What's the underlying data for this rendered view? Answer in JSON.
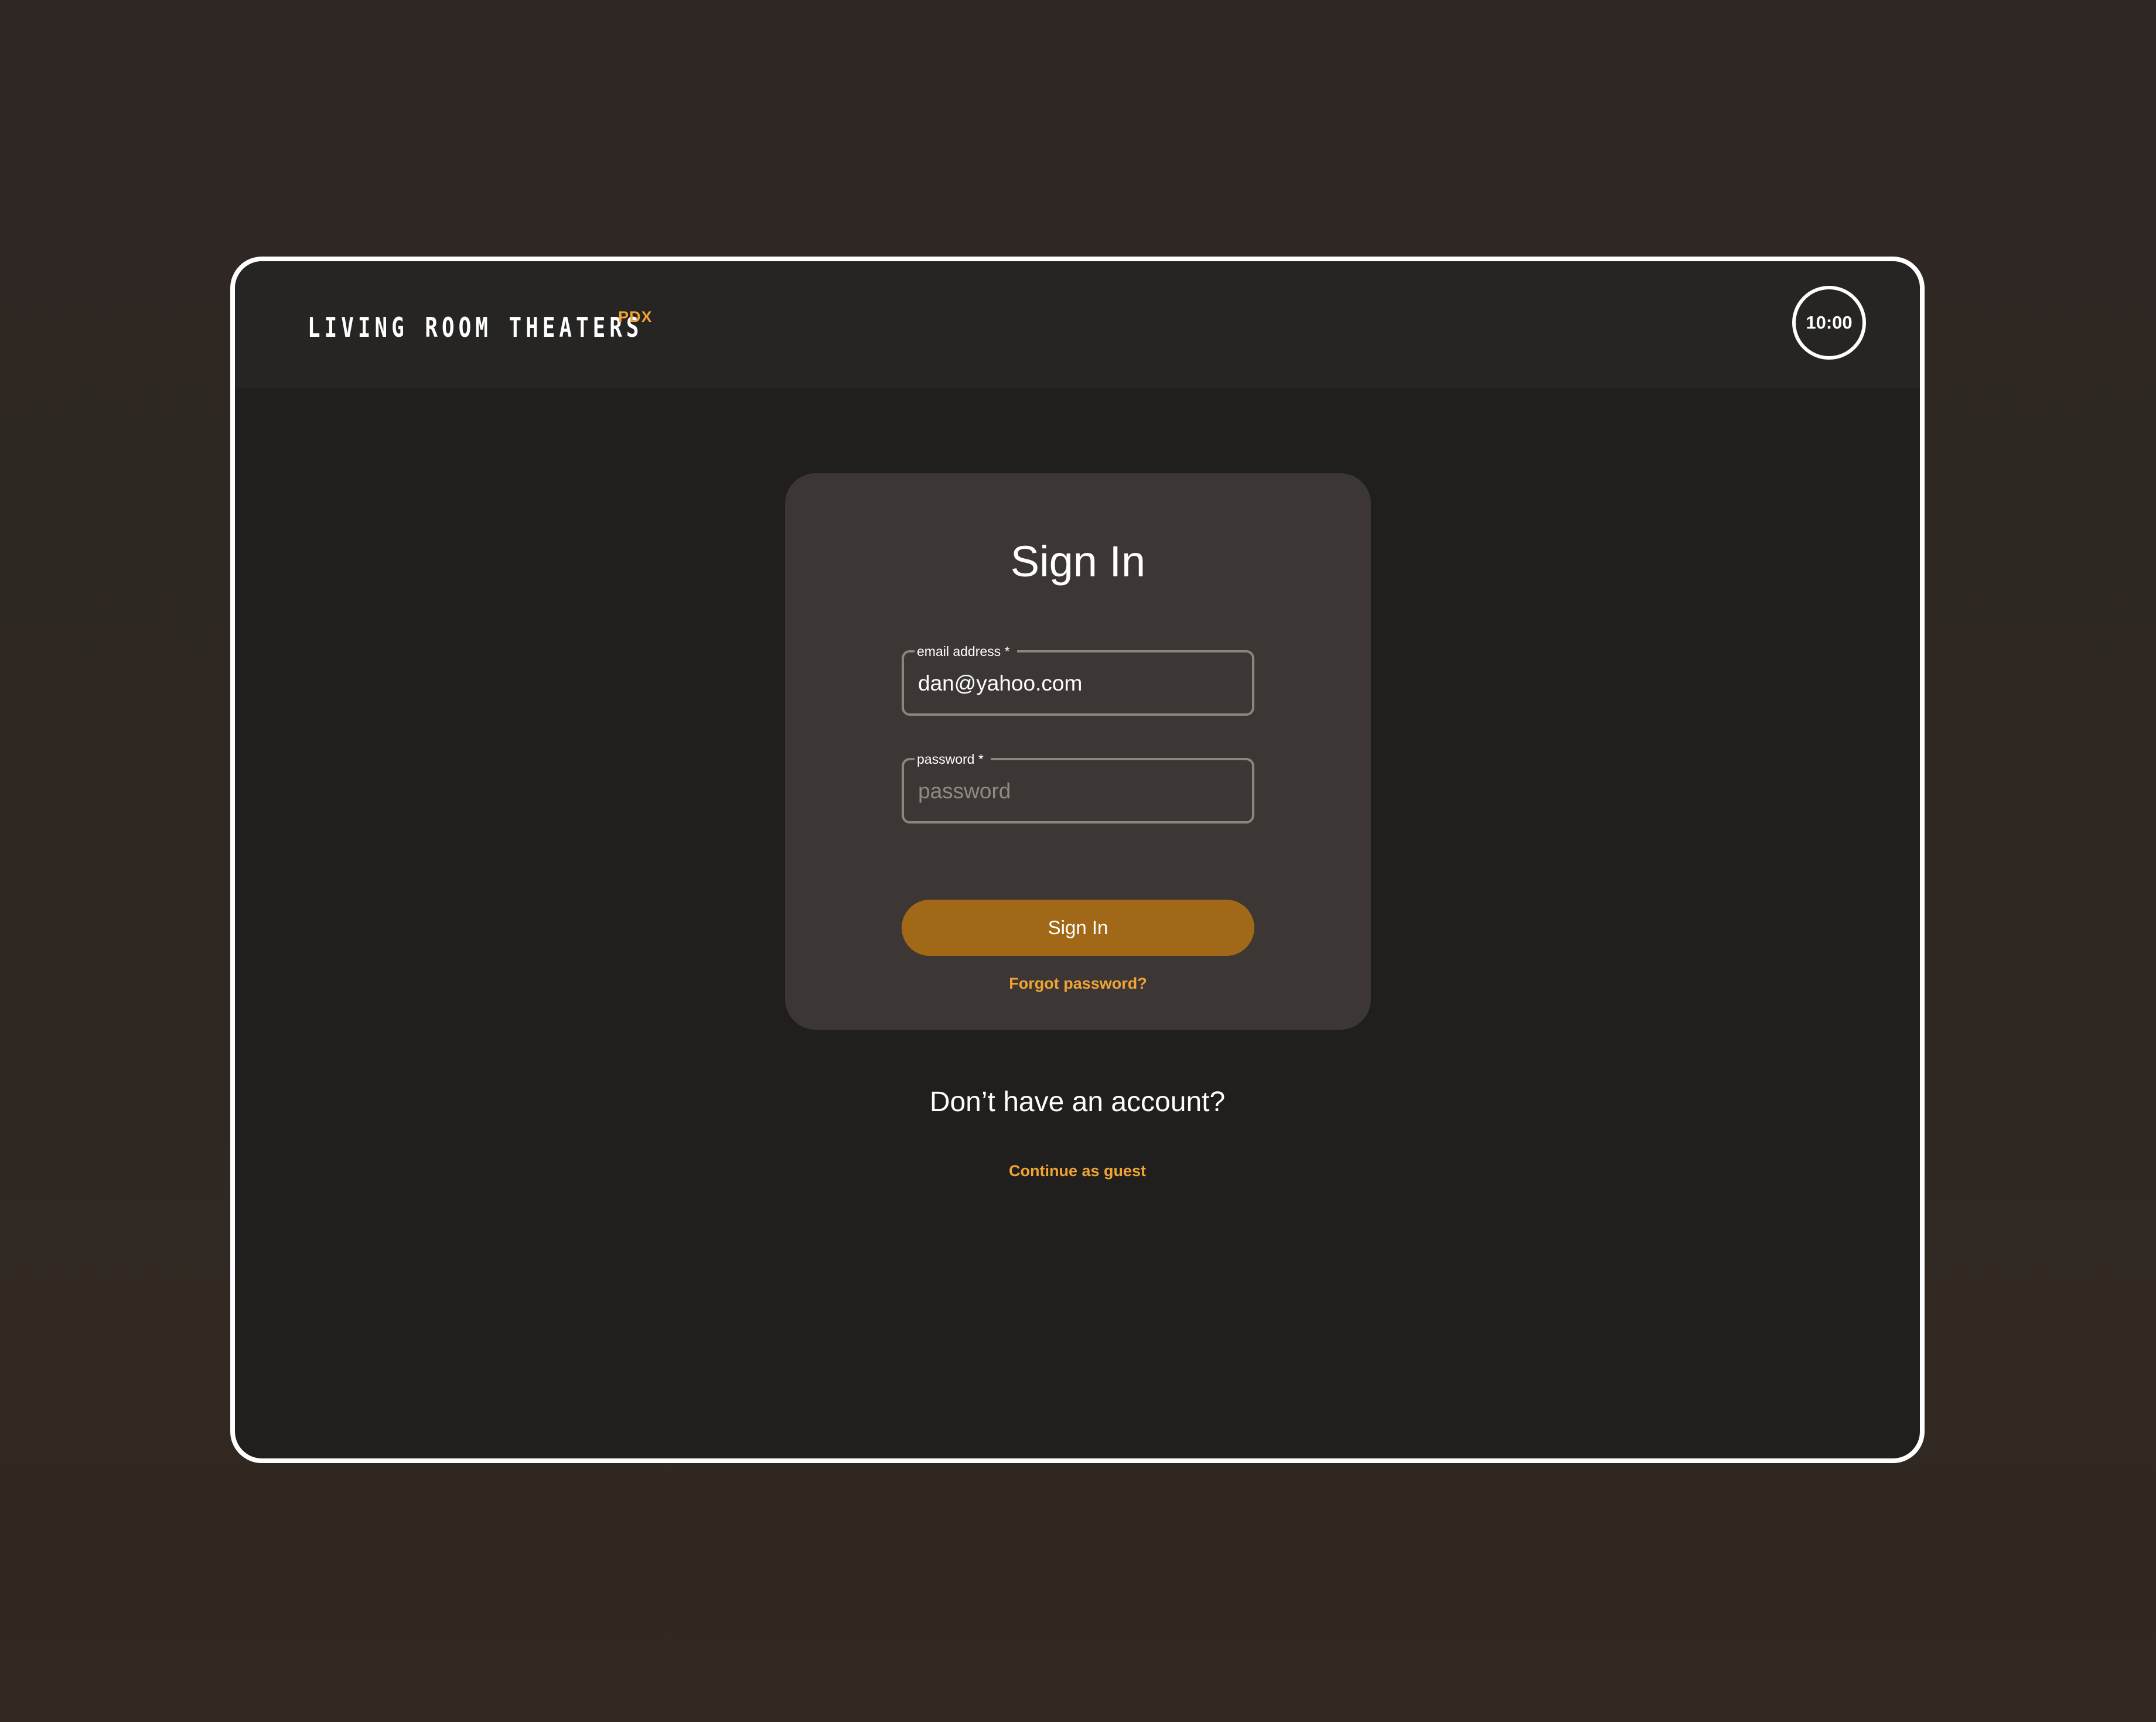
{
  "header": {
    "brand_name": "LIVING ROOM THEATERS",
    "brand_suffix": "PDX",
    "timer": "10:00"
  },
  "signin_card": {
    "title": "Sign In",
    "email_field": {
      "label": "email address *",
      "value": "dan@yahoo.com"
    },
    "password_field": {
      "label": "password *",
      "placeholder": "password",
      "value": ""
    },
    "submit_label": "Sign In",
    "forgot_password": "Forgot password?"
  },
  "guest_section": {
    "prompt": "Don’t have an account?",
    "continue_as_guest": "Continue as guest"
  },
  "colors": {
    "accent": "#f0a433",
    "button": "#a16817",
    "card_background": "#3c3735",
    "screen_background": "#201f1d"
  }
}
